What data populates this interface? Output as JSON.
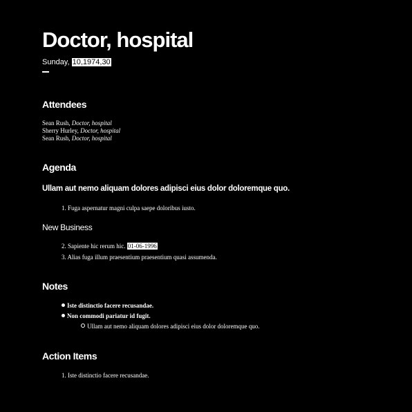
{
  "title": "Doctor, hospital",
  "date": {
    "day": "Sunday,",
    "highlighted": "10,1974,30"
  },
  "attendees": {
    "heading": "Attendees",
    "items": [
      {
        "name": "Sean Rush,",
        "role": "Doctor, hospital"
      },
      {
        "name": "Sherry Hurley,",
        "role": "Doctor, hospital"
      },
      {
        "name": "Sean Rush,",
        "role": "Doctor, hospital"
      }
    ]
  },
  "agenda": {
    "heading": "Agenda",
    "subheading": "Ullam aut nemo aliquam dolores adipisci eius dolor doloremque quo.",
    "items": [
      {
        "num": "1.",
        "text": "Fuga aspernatur magni culpa saepe doloribus iusto."
      }
    ],
    "new_business": {
      "heading": "New Business",
      "items": [
        {
          "num": "2.",
          "text": "Sapiente hic rerum hic.",
          "highlight": "01-06-1996"
        },
        {
          "num": "3.",
          "text": "Alias fuga illum praesentium praesentium quasi assumenda."
        }
      ]
    }
  },
  "notes": {
    "heading": "Notes",
    "items": [
      {
        "text": "Iste distinctio facere recusandae."
      },
      {
        "text": "Non commodi pariatur id fugit."
      }
    ],
    "subitem": "Ullam aut nemo aliquam dolores adipisci eius dolor doloremque quo."
  },
  "action_items": {
    "heading": "Action Items",
    "items": [
      {
        "num": "1.",
        "text": "Iste distinctio facere recusandae."
      }
    ]
  }
}
